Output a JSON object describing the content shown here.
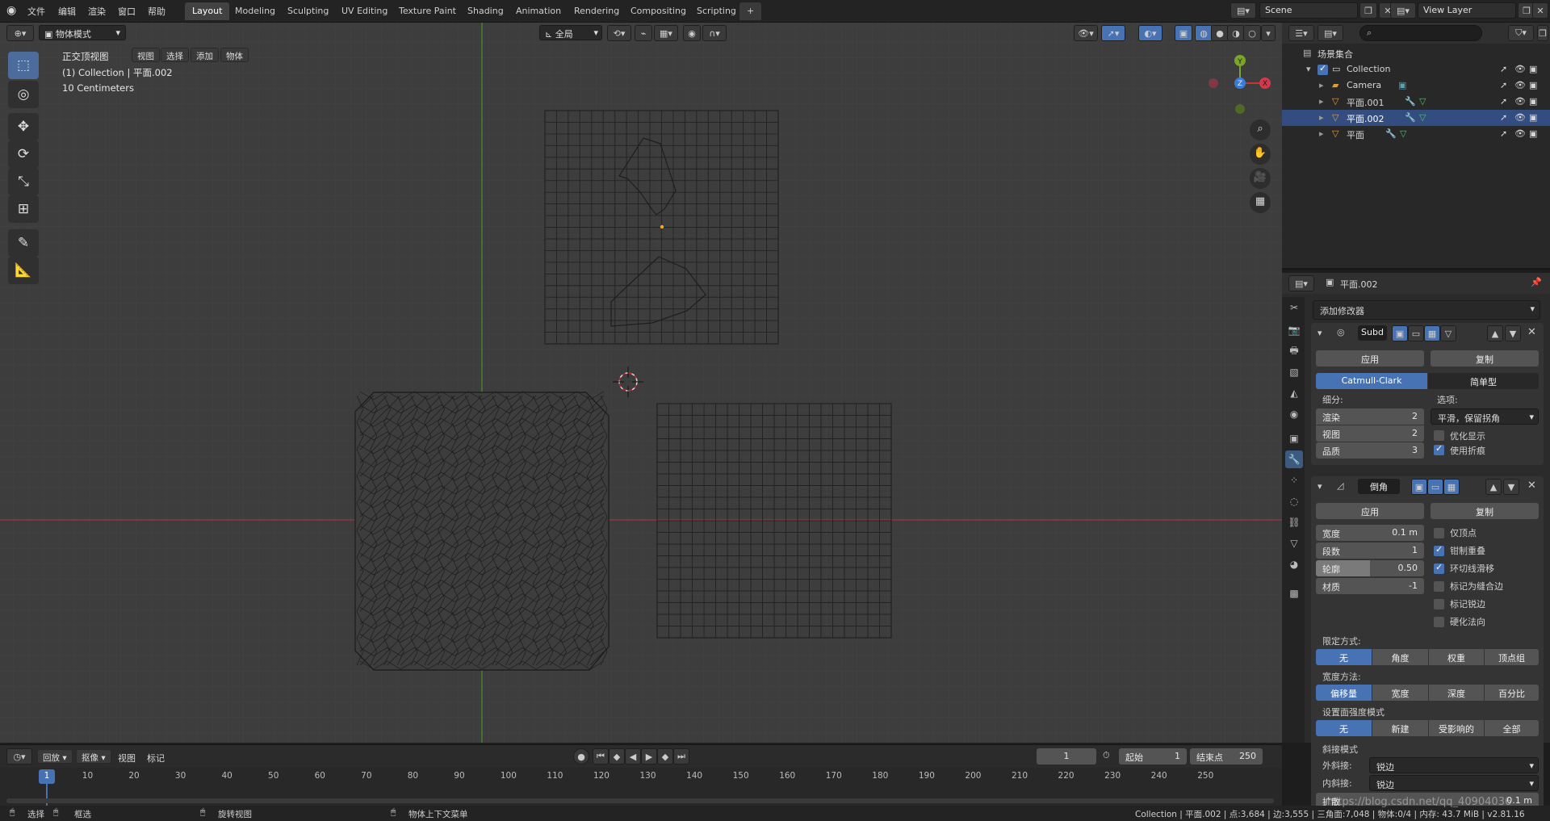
{
  "topbar": {
    "menu": [
      "文件",
      "编辑",
      "渲染",
      "窗口",
      "帮助"
    ],
    "workspaces": [
      "Layout",
      "Modeling",
      "Sculpting",
      "UV Editing",
      "Texture Paint",
      "Shading",
      "Animation",
      "Rendering",
      "Compositing",
      "Scripting"
    ],
    "add_tab": "+",
    "scene": "Scene",
    "view_layer": "View Layer"
  },
  "viewport": {
    "mode": "物体模式",
    "menu": [
      "视图",
      "选择",
      "添加",
      "物体"
    ],
    "transform_orientation": "全局",
    "overlay_view_name": "正交顶视图",
    "overlay_collection": "(1) Collection | 平面.002",
    "overlay_scale": "10 Centimeters",
    "gizmo_axes": {
      "y": "Y",
      "z": "Z",
      "x": "X"
    }
  },
  "outliner": {
    "search_placeholder": "",
    "root": "场景集合",
    "items": [
      {
        "label": "Collection",
        "icon": "collection-icon"
      },
      {
        "label": "Camera",
        "icon": "camera-icon"
      },
      {
        "label": "平面.001",
        "icon": "mesh-icon"
      },
      {
        "label": "平面.002",
        "icon": "mesh-icon"
      },
      {
        "label": "平面",
        "icon": "mesh-icon"
      }
    ]
  },
  "properties": {
    "object_name": "平面.002",
    "add_modifier": "添加修改器",
    "subsurf": {
      "name": "Subd",
      "apply": "应用",
      "copy": "复制",
      "alg_catmull": "Catmull-Clark",
      "alg_simple": "简单型",
      "subdiv_label": "细分:",
      "options_label": "选项:",
      "render_label": "渲染",
      "render_value": "2",
      "view_label": "视图",
      "view_value": "2",
      "quality_label": "品质",
      "quality_value": "3",
      "uv_mode": "平滑，保留拐角",
      "opt_display": "优化显示",
      "use_crease": "使用折痕"
    },
    "bevel": {
      "name": "倒角",
      "apply": "应用",
      "copy": "复制",
      "width_label": "宽度",
      "width_value": "0.1 m",
      "segments_label": "段数",
      "segments_value": "1",
      "profile_label": "轮廓",
      "profile_value": "0.50",
      "profile_fraction": 0.5,
      "material_label": "材质",
      "material_value": "-1",
      "only_vertices": "仅顶点",
      "clamp_overlap": "钳制重叠",
      "loop_slide": "环切线滑移",
      "mark_seam": "标记为缝合边",
      "mark_sharp": "标记锐边",
      "harden_normals": "硬化法向",
      "limit_method_label": "限定方式:",
      "limit_methods": [
        "无",
        "角度",
        "权重",
        "顶点组"
      ],
      "width_method_label": "宽度方法:",
      "width_methods": [
        "偏移量",
        "宽度",
        "深度",
        "百分比"
      ],
      "face_strength_label": "设置面强度模式",
      "face_strength": [
        "无",
        "新建",
        "受影响的",
        "全部"
      ],
      "miter_label": "斜接模式",
      "outer_miter_label": "外斜接:",
      "outer_miter": "锐边",
      "inner_miter_label": "内斜接:",
      "inner_miter": "锐边",
      "spread_label": "扩散",
      "spread_value": "0.1 m"
    }
  },
  "timeline": {
    "menus": [
      "回放",
      "抠像",
      "视图",
      "标记"
    ],
    "current_frame": "1",
    "start_label": "起始",
    "start_value": "1",
    "end_label": "结束点",
    "end_value": "250",
    "ticks": [
      "1",
      "10",
      "20",
      "30",
      "40",
      "50",
      "60",
      "70",
      "80",
      "90",
      "100",
      "110",
      "120",
      "130",
      "140",
      "150",
      "160",
      "170",
      "180",
      "190",
      "200",
      "210",
      "220",
      "230",
      "240",
      "250"
    ]
  },
  "statusbar": {
    "select": "选择",
    "box_select": "框选",
    "rotate_view": "旋转视图",
    "context_menu": "物体上下文菜单",
    "stats": "Collection | 平面.002 | 点:3,684 | 边:3,555 | 三角面:7,048 | 物体:0/4 | 内存: 43.7 MiB | v2.81.16",
    "watermark": "https://blog.csdn.net/qq_40904036"
  },
  "colors": {
    "accent": "#4772b3",
    "viewport_bg": "#3d3d3d",
    "x_axis": "#b0343f",
    "y_axis": "#4b8a2b"
  }
}
